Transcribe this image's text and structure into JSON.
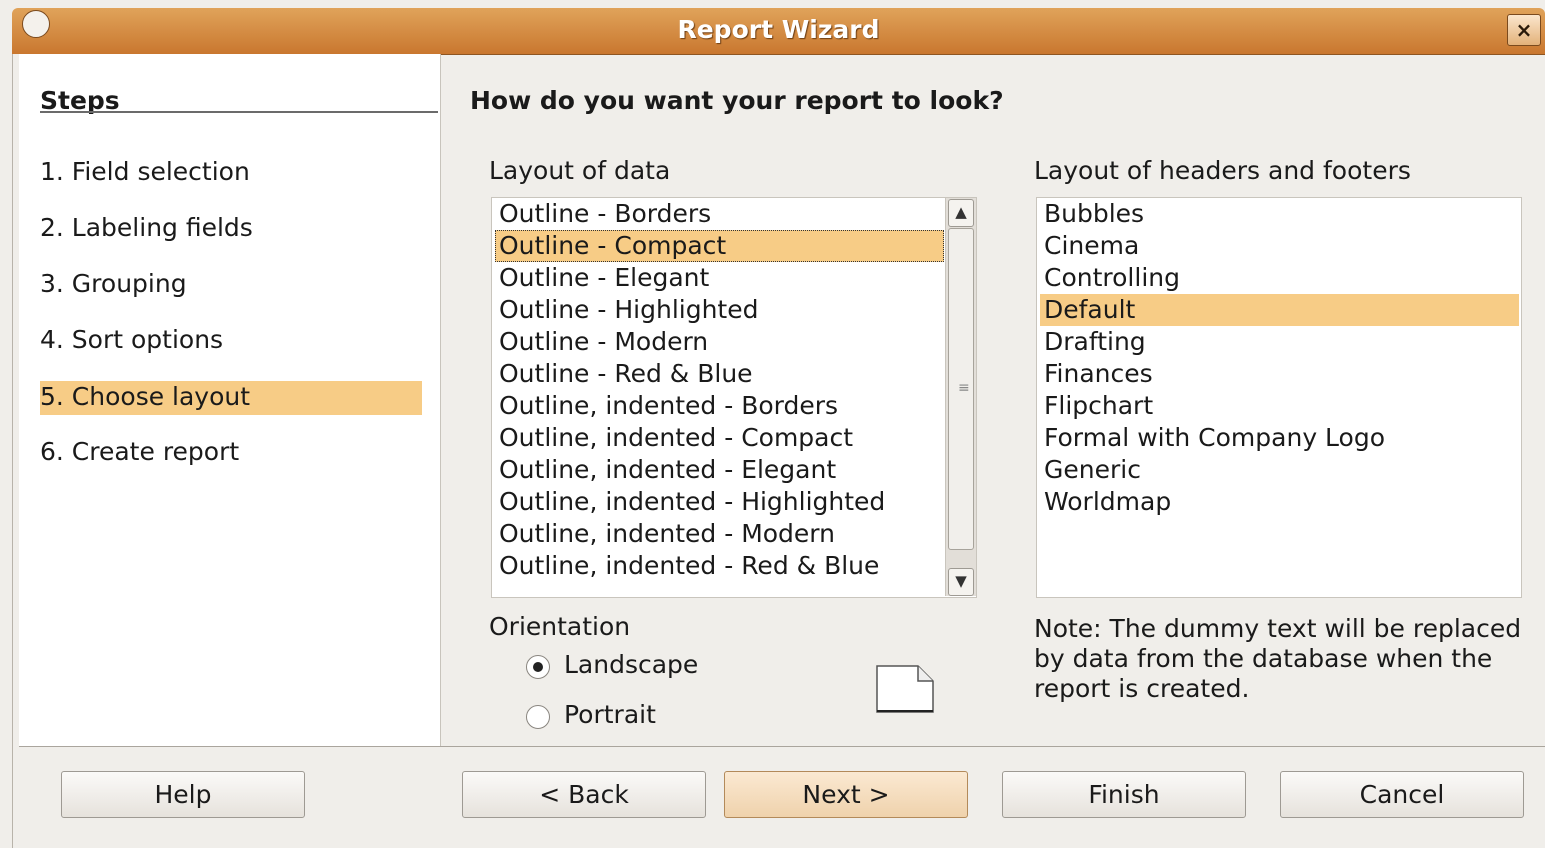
{
  "window": {
    "title": "Report Wizard",
    "close_label": "×"
  },
  "steps": {
    "heading": "Steps",
    "items": [
      {
        "label": "1. Field selection",
        "active": false
      },
      {
        "label": "2. Labeling fields",
        "active": false
      },
      {
        "label": "3. Grouping",
        "active": false
      },
      {
        "label": "4. Sort options",
        "active": false
      },
      {
        "label": "5. Choose layout",
        "active": true
      },
      {
        "label": "6. Create report",
        "active": false
      }
    ]
  },
  "main": {
    "question": "How do you want your report to look?",
    "data_layout": {
      "label": "Layout of data",
      "selected": "Outline - Compact",
      "items": [
        "Outline - Borders",
        "Outline - Compact",
        "Outline - Elegant",
        "Outline - Highlighted",
        "Outline - Modern",
        "Outline - Red & Blue",
        "Outline, indented - Borders",
        "Outline, indented - Compact",
        "Outline, indented - Elegant",
        "Outline, indented - Highlighted",
        "Outline, indented - Modern",
        "Outline, indented - Red & Blue"
      ]
    },
    "header_layout": {
      "label": "Layout of headers and footers",
      "selected": "Default",
      "items": [
        "Bubbles",
        "Cinema",
        "Controlling",
        "Default",
        "Drafting",
        "Finances",
        "Flipchart",
        "Formal with Company Logo",
        "Generic",
        "Worldmap"
      ]
    },
    "orientation": {
      "label": "Orientation",
      "landscape": "Landscape",
      "portrait": "Portrait",
      "selected": "Landscape"
    },
    "note": "Note: The dummy text will be replaced by data from the database when the report is created."
  },
  "buttons": {
    "help": "Help",
    "back": "< Back",
    "next": "Next >",
    "finish": "Finish",
    "cancel": "Cancel"
  },
  "colors": {
    "selection": "#f7cc86",
    "titlebar": "#d08a40"
  }
}
